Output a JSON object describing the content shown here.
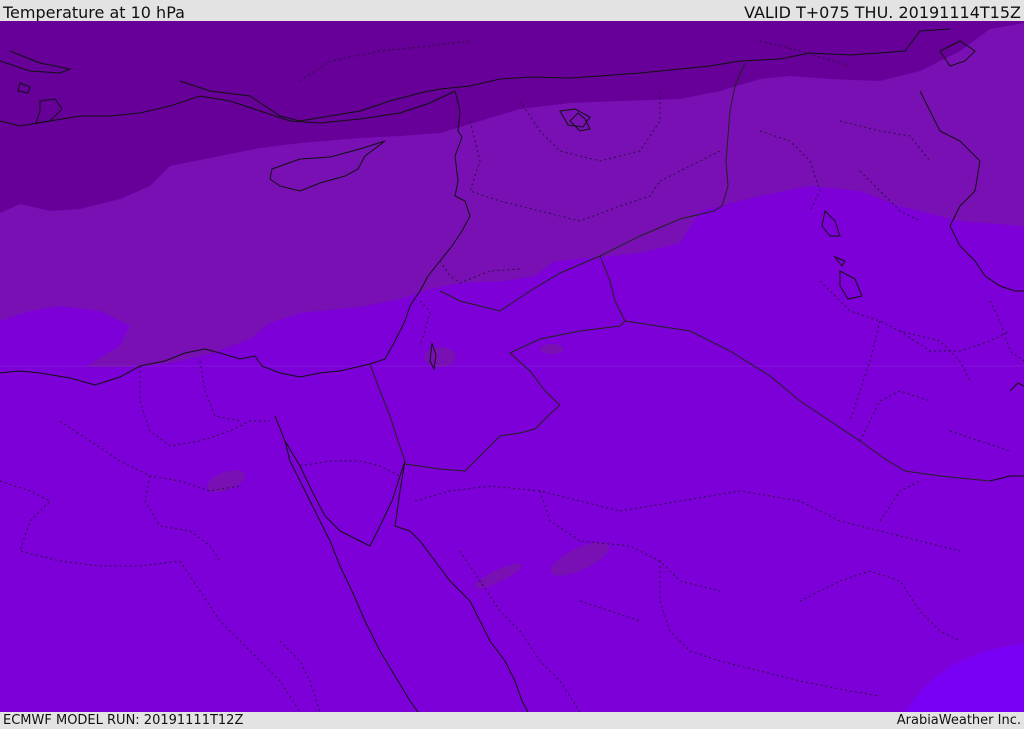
{
  "header": {
    "title": "Temperature at 10 hPa",
    "valid": "VALID T+075 THU. 20191114T15Z"
  },
  "footer": {
    "model_run": "ECMWF MODEL RUN: 20191111T12Z",
    "credit": "ArabiaWeather Inc."
  },
  "map": {
    "colors": {
      "coldest_band": "#660099",
      "cold_band": "#7810b4",
      "mid_band": "#7d00d9",
      "warm_band": "#7a00f5",
      "coastline": "#111111",
      "border": "#222222"
    }
  }
}
